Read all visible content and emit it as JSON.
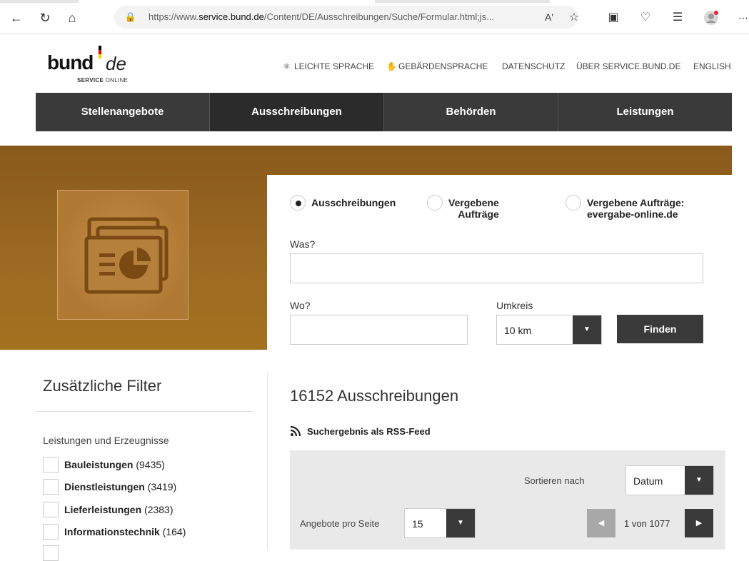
{
  "browser": {
    "url_prefix": "https://www.",
    "url_domain": "service.bund.de",
    "url_path": "/Content/DE/Ausschreibungen/Suche/Formular.html;js...",
    "read_aloud": "Aʹ"
  },
  "header": {
    "logo_bund": "bund",
    "logo_de": "de",
    "logo_service_bold": "SERVICE",
    "logo_service_rest": " ONLINE",
    "links": {
      "leichte_sprache": "LEICHTE SPRACHE",
      "gebaerdensprache": "GEBÄRDENSPRACHE",
      "datenschutz": "DATENSCHUTZ",
      "ueber": "ÜBER SERVICE.BUND.DE",
      "english": "ENGLISH"
    }
  },
  "nav": {
    "stellenangebote": "Stellenangebote",
    "ausschreibungen": "Ausschreibungen",
    "behoerden": "Behörden",
    "leistungen": "Leistungen"
  },
  "search": {
    "radio_ausschreibungen": "Ausschreibungen",
    "radio_vergebene_line1": "Vergebene",
    "radio_vergebene_line2": "Aufträge",
    "radio_evergabe_line1": "Vergebene Aufträge:",
    "radio_evergabe_line2": "evergabe-online.de",
    "was_label": "Was?",
    "was_value": "",
    "wo_label": "Wo?",
    "wo_value": "",
    "umkreis_label": "Umkreis",
    "umkreis_value": "10 km",
    "finden_label": "Finden"
  },
  "filters": {
    "title": "Zusätzliche Filter",
    "group_title": "Leistungen und Erzeugnisse",
    "items": [
      {
        "name": "Bauleistungen",
        "count": " (9435)"
      },
      {
        "name": "Dienstleistungen",
        "count": " (3419)"
      },
      {
        "name": "Lieferleistungen",
        "count": " (2383)"
      },
      {
        "name": "Informationstechnik",
        "count": " (164)"
      }
    ]
  },
  "results": {
    "title": "16152 Ausschreibungen",
    "rss_label": "Suchergebnis als RSS-Feed",
    "sort_label": "Sortieren nach",
    "sort_value": "Datum",
    "per_page_label": "Angebote pro Seite",
    "per_page_value": "15",
    "pagination": "1 von 1077"
  },
  "colors": {
    "hero_brown": "#9c6a22",
    "nav_dark": "#333333",
    "button_dark": "#3a3a3a"
  }
}
